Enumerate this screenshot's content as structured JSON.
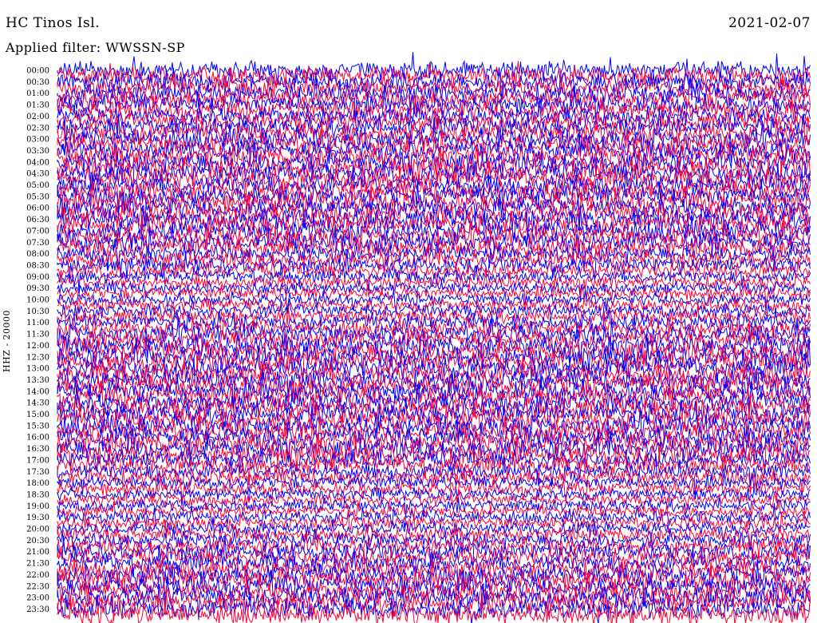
{
  "header": {
    "station": "HC Tinos Isl.",
    "date": "2021-02-07",
    "filter": "Applied filter: WWSSN-SP"
  },
  "channel_label": "HHZ - 20000",
  "colors": {
    "trace_odd": "#0000ff",
    "trace_even": "#ff0033",
    "background": "#ffffff"
  },
  "chart_data": {
    "type": "line",
    "title": "HC Tinos Isl.",
    "subtitle": "Applied filter: WWSSN-SP",
    "ylabel": "HHZ - 20000",
    "y_tick_labels": [
      "00:00",
      "00:30",
      "01:00",
      "01:30",
      "02:00",
      "02:30",
      "03:00",
      "03:30",
      "04:00",
      "04:30",
      "05:00",
      "05:30",
      "06:00",
      "06:30",
      "07:00",
      "07:30",
      "08:00",
      "08:30",
      "09:00",
      "09:30",
      "10:00",
      "10:30",
      "11:00",
      "11:30",
      "12:00",
      "12:30",
      "13:00",
      "13:30",
      "14:00",
      "14:30",
      "15:00",
      "15:30",
      "16:00",
      "16:30",
      "17:00",
      "17:30",
      "18:00",
      "18:30",
      "19:00",
      "19:30",
      "20:00",
      "20:30",
      "21:00",
      "21:30",
      "22:00",
      "22:30",
      "23:00",
      "23:30"
    ],
    "trace_minutes": 15,
    "trace_colors_alternating": [
      "blue",
      "red"
    ],
    "relative_amplitude": [
      0.9,
      0.9,
      0.95,
      0.9,
      0.9,
      0.95,
      1.0,
      1.0,
      1.0,
      1.0,
      1.0,
      1.0,
      1.0,
      1.0,
      1.0,
      1.0,
      0.8,
      0.75,
      0.65,
      0.6,
      0.6,
      0.7,
      0.8,
      0.95,
      1.0,
      1.0,
      1.0,
      1.0,
      1.0,
      1.0,
      1.0,
      1.0,
      1.0,
      1.0,
      0.85,
      0.8,
      0.65,
      0.6,
      0.6,
      0.65,
      0.7,
      0.75,
      0.85,
      0.9,
      1.0,
      1.0,
      1.0,
      1.0
    ],
    "grid": false
  }
}
